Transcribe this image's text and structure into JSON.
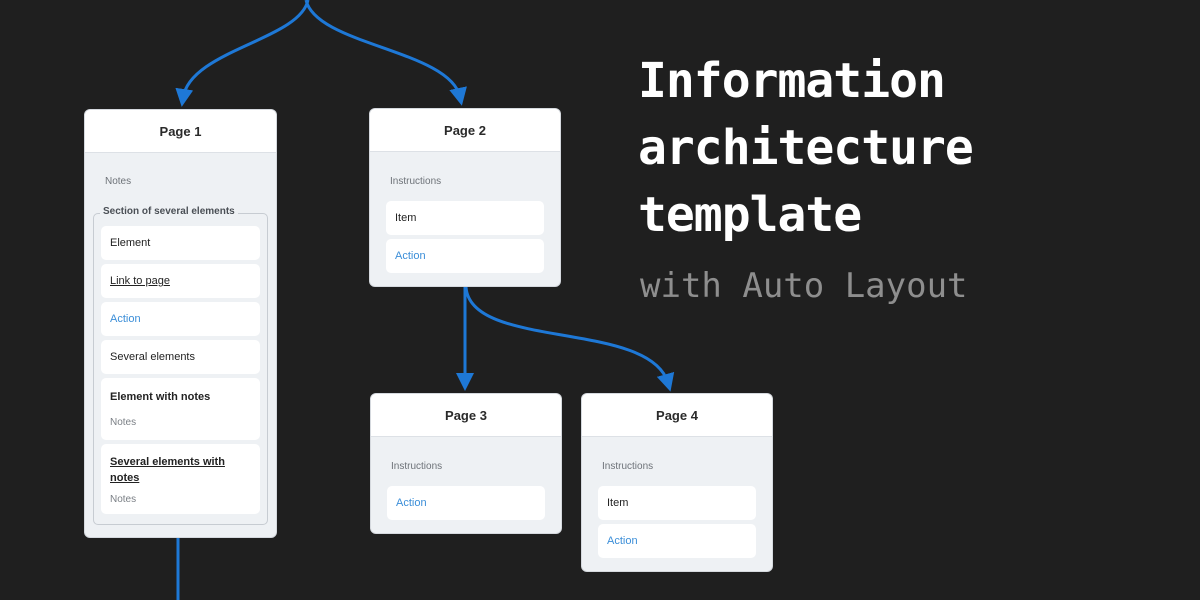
{
  "colors": {
    "background": "#1f1f1f",
    "connector": "#1e78d6",
    "card_body": "#eef1f4",
    "action_text": "#3b8ed8"
  },
  "heading": {
    "title_lines": [
      "Information",
      "architecture",
      "template"
    ],
    "subtitle": "with Auto Layout"
  },
  "pages": [
    {
      "title": "Page 1",
      "note": "Notes",
      "section": {
        "label": "Section of several elements",
        "items": [
          {
            "text": "Element",
            "kind": "element"
          },
          {
            "text": "Link to page",
            "kind": "link"
          },
          {
            "text": "Action",
            "kind": "action"
          },
          {
            "text": "Several elements",
            "kind": "element"
          },
          {
            "text": "Element with notes",
            "notes": "Notes",
            "kind": "element-with-notes"
          },
          {
            "text": "Several elements with notes",
            "notes": "Notes",
            "kind": "link-with-notes"
          }
        ]
      }
    },
    {
      "title": "Page 2",
      "note": "Instructions",
      "items": [
        {
          "text": "Item",
          "kind": "element"
        },
        {
          "text": "Action",
          "kind": "action"
        }
      ]
    },
    {
      "title": "Page 3",
      "note": "Instructions",
      "items": [
        {
          "text": "Action",
          "kind": "action"
        }
      ]
    },
    {
      "title": "Page 4",
      "note": "Instructions",
      "items": [
        {
          "text": "Item",
          "kind": "element"
        },
        {
          "text": "Action",
          "kind": "action"
        }
      ]
    }
  ],
  "connections": [
    {
      "from": "root",
      "to": "Page 1"
    },
    {
      "from": "root",
      "to": "Page 2"
    },
    {
      "from": "Page 2",
      "to": "Page 3"
    },
    {
      "from": "Page 2",
      "to": "Page 4"
    },
    {
      "from": "Page 1",
      "to": "offscreen"
    }
  ]
}
